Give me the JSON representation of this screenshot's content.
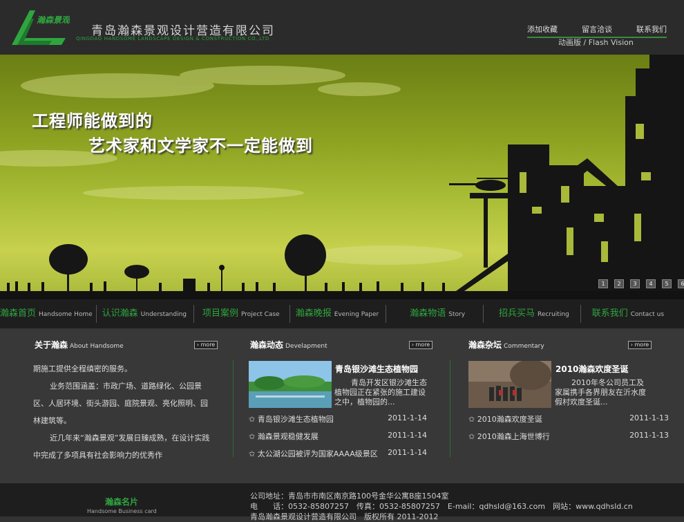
{
  "header": {
    "logo_text": "瀚森景观",
    "company_cn": "青岛瀚森景观设计营造有限公司",
    "company_en": "QINGDAO HANDSOME LANDSCAPE DESIGN & CONSTRUCTION CO.,LTD",
    "links": [
      "添加收藏",
      "留言洽谈",
      "联系我们"
    ],
    "flash_link": "动画版 / Flash Vision"
  },
  "banner": {
    "line1": "工程师能做到的",
    "line2": "艺术家和文学家不一定能做到",
    "pager": [
      "1",
      "2",
      "3",
      "4",
      "5",
      "6"
    ]
  },
  "nav": [
    {
      "cn": "瀚森首页",
      "en": "Handsome Home"
    },
    {
      "cn": "认识瀚森",
      "en": "Understanding"
    },
    {
      "cn": "项目案例",
      "en": "Project Case"
    },
    {
      "cn": "瀚森晚报",
      "en": "Evening Paper"
    },
    {
      "cn": "瀚森物语",
      "en": "Story"
    },
    {
      "cn": "招兵买马",
      "en": "Recruiting"
    },
    {
      "cn": "联系我们",
      "en": "Contact us"
    }
  ],
  "about": {
    "title_cn": "关于瀚森",
    "title_en": "About Handsome",
    "more": "› more",
    "paragraphs": [
      "期施工提供全程缜密的服务。",
      "业务范围涵盖：市政广场、道路绿化、公园景区、人居环境、街头游园、庭院景观、亮化照明、园林建筑等。",
      "近几年来“瀚森景观”发展日臻成熟，在设计实践中完成了多项具有社会影响力的优秀作"
    ]
  },
  "news": {
    "title_cn": "瀚森动态",
    "title_en": "Develapment",
    "more": "› more",
    "featured_title": "青岛银沙滩生态植物园",
    "featured_desc": "青岛开发区银沙滩生态植物园正在紧张的施工建设之中，植物园的...",
    "items": [
      {
        "title": "✩ 青岛银沙滩生态植物园",
        "date": "2011-1-14"
      },
      {
        "title": "✩ 瀚森景观稳健发展",
        "date": "2011-1-14"
      },
      {
        "title": "✩ 太公湖公园被评为国家AAAA级景区",
        "date": "2011-1-14"
      }
    ]
  },
  "forum": {
    "title_cn": "瀚森杂坛",
    "title_en": "Commentary",
    "more": "› more",
    "featured_title": "2010瀚森欢度圣诞",
    "featured_desc": "2010年冬公司员工及家属携手各界朋友在沂水度假村欢度圣诞...",
    "items": [
      {
        "title": "✩ 2010瀚森欢度圣诞",
        "date": "2011-1-13"
      },
      {
        "title": "✩ 2010瀚森上海世博行",
        "date": "2011-1-13"
      }
    ]
  },
  "footer": {
    "card_cn": "瀚森名片",
    "card_en": "Handsome Business card",
    "address": "公司地址：青岛市市南区南京路100号金华公寓B座1504室",
    "contact": "电　　话：0532-85807257　传真：0532-85807257　E-mail：qdhsld@163.com　网站：www.qdhsld.cn",
    "copyright": "青岛瀚森景观设计营造有限公司　版权所有 2011-2012"
  },
  "colors": {
    "accent_green": "#2fa53f",
    "dark_bar": "#1e1e1e",
    "content_bg": "#383838"
  }
}
